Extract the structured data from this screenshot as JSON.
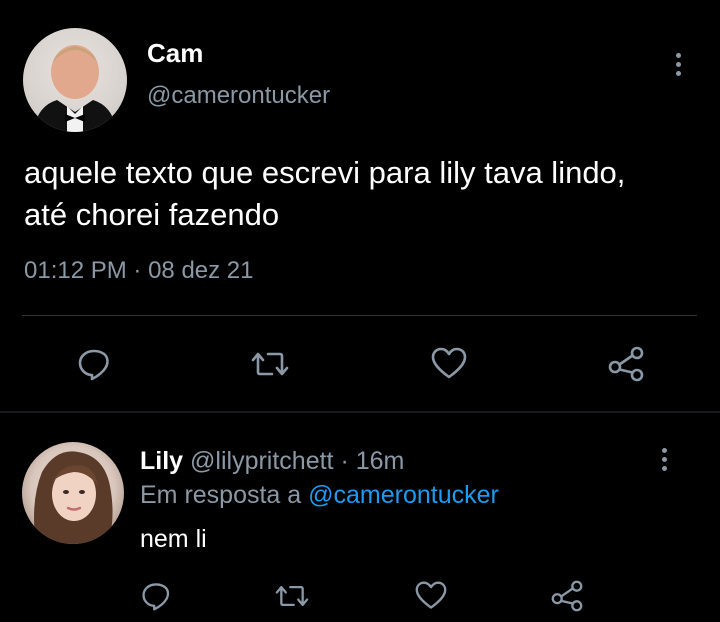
{
  "tweet": {
    "author": {
      "name": "Cam",
      "handle": "@camerontucker"
    },
    "text": "aquele texto que escrevi para lily tava lindo, até chorei fazendo",
    "time": "01:12 PM",
    "separator": "·",
    "date": "08 dez 21"
  },
  "reply": {
    "author": {
      "name": "Lily",
      "handle": "@lilypritchett"
    },
    "separator": "·",
    "age": "16m",
    "context_prefix": "Em resposta a",
    "context_mention": "@camerontucker",
    "text": "nem li"
  },
  "icons": {
    "reply": "speech-bubble-icon",
    "retweet": "retweet-icon",
    "like": "heart-icon",
    "share": "share-icon",
    "more": "vertical-dots-icon"
  },
  "colors": {
    "background": "#000000",
    "primary_text": "#ffffff",
    "secondary_text": "#8b98a5",
    "link": "#1d9bf0",
    "divider": "#2f3336"
  }
}
